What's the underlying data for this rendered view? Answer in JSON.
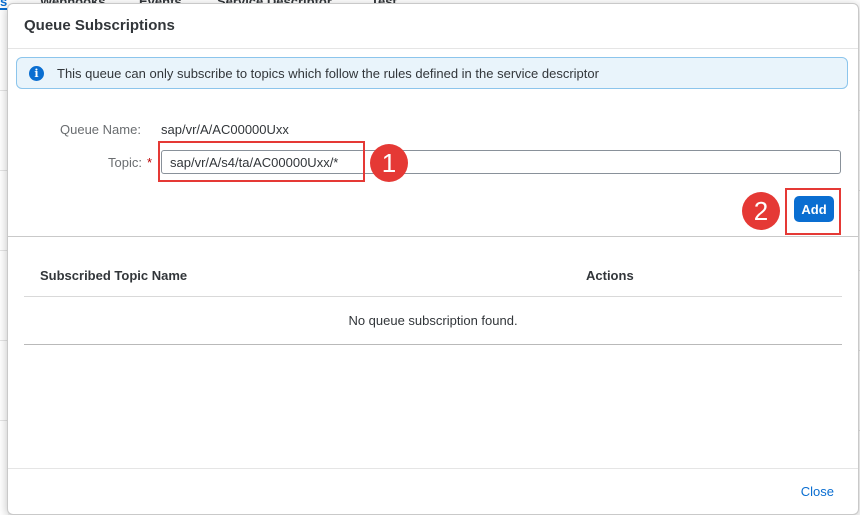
{
  "background": {
    "tabs": [
      "s",
      "Webhooks",
      "Events",
      "Service Descriptor",
      "Test"
    ]
  },
  "dialog": {
    "title": "Queue Subscriptions",
    "info_message": "This queue can only subscribe to topics which follow the rules defined in the service descriptor",
    "info_icon": "info-icon",
    "queue_name_label": "Queue Name:",
    "queue_name_value": "sap/vr/A/AC00000Uxx",
    "topic_label": "Topic:",
    "required_marker": "*",
    "topic_value": "sap/vr/A/s4/ta/AC00000Uxx/*",
    "add_label": "Add",
    "callouts": [
      "1",
      "2"
    ],
    "table": {
      "columns": [
        "Subscribed Topic Name",
        "Actions"
      ],
      "empty_text": "No queue subscription found."
    },
    "close_label": "Close"
  },
  "colors": {
    "accent": "#0a6ed1",
    "callout": "#e53935",
    "info_bg": "#e9f4fb"
  }
}
